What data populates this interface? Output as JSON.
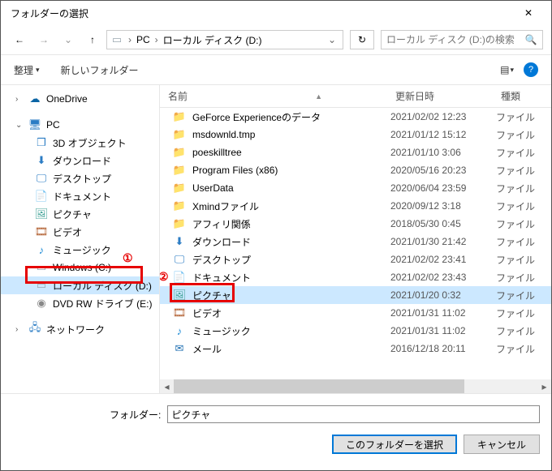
{
  "window": {
    "title": "フォルダーの選択",
    "close_icon": "✕"
  },
  "nav": {
    "back_icon": "←",
    "forward_icon": "→",
    "up_icon": "↑",
    "pc_label": "PC",
    "disk_label": "ローカル ディスク (D:)",
    "dropdown_icon": "⌄",
    "reload_icon": "↻",
    "search_placeholder": "ローカル ディスク (D:)の検索",
    "search_icon": "🔍"
  },
  "toolbar": {
    "organize": "整理",
    "newfolder": "新しいフォルダー",
    "view_dd": "⌄",
    "help": "?"
  },
  "tree": {
    "onedrive": "OneDrive",
    "pc": "PC",
    "items": [
      {
        "icon": "3d",
        "label": "3D オブジェクト"
      },
      {
        "icon": "dl",
        "label": "ダウンロード"
      },
      {
        "icon": "desktop",
        "label": "デスクトップ"
      },
      {
        "icon": "doc",
        "label": "ドキュメント"
      },
      {
        "icon": "pic",
        "label": "ピクチャ"
      },
      {
        "icon": "vid",
        "label": "ビデオ"
      },
      {
        "icon": "music",
        "label": "ミュージック"
      },
      {
        "icon": "disk",
        "label": "Windows (C:)"
      },
      {
        "icon": "disk",
        "label": "ローカル ディスク (D:)",
        "selected": true
      },
      {
        "icon": "dvd",
        "label": "DVD RW ドライブ (E:)"
      }
    ],
    "network": "ネットワーク"
  },
  "columns": {
    "name": "名前",
    "date": "更新日時",
    "type": "種類"
  },
  "rows": [
    {
      "icon": "folder",
      "name": "GeForce Experienceのデータ",
      "date": "2021/02/02 12:23",
      "type": "ファイル"
    },
    {
      "icon": "folder",
      "name": "msdownld.tmp",
      "date": "2021/01/12 15:12",
      "type": "ファイル"
    },
    {
      "icon": "folder",
      "name": "poeskilltree",
      "date": "2021/01/10 3:06",
      "type": "ファイル"
    },
    {
      "icon": "folder",
      "name": "Program Files (x86)",
      "date": "2020/05/16 20:23",
      "type": "ファイル"
    },
    {
      "icon": "folder",
      "name": "UserData",
      "date": "2020/06/04 23:59",
      "type": "ファイル"
    },
    {
      "icon": "folder",
      "name": "Xmindファイル",
      "date": "2020/09/12 3:18",
      "type": "ファイル"
    },
    {
      "icon": "folder",
      "name": "アフィリ関係",
      "date": "2018/05/30 0:45",
      "type": "ファイル"
    },
    {
      "icon": "dl",
      "name": "ダウンロード",
      "date": "2021/01/30 21:42",
      "type": "ファイル"
    },
    {
      "icon": "desktop",
      "name": "デスクトップ",
      "date": "2021/02/02 23:41",
      "type": "ファイル"
    },
    {
      "icon": "doc",
      "name": "ドキュメント",
      "date": "2021/02/02 23:43",
      "type": "ファイル"
    },
    {
      "icon": "pic",
      "name": "ピクチャ",
      "date": "2021/01/20 0:32",
      "type": "ファイル",
      "selected": true
    },
    {
      "icon": "vid",
      "name": "ビデオ",
      "date": "2021/01/31 11:02",
      "type": "ファイル"
    },
    {
      "icon": "music",
      "name": "ミュージック",
      "date": "2021/01/31 11:02",
      "type": "ファイル"
    },
    {
      "icon": "mail",
      "name": "メール",
      "date": "2016/12/18 20:11",
      "type": "ファイル"
    }
  ],
  "footer": {
    "folder_label": "フォルダー:",
    "folder_value": "ピクチャ",
    "select_btn": "このフォルダーを選択",
    "cancel_btn": "キャンセル"
  },
  "annotations": {
    "one": "①",
    "two": "②"
  }
}
